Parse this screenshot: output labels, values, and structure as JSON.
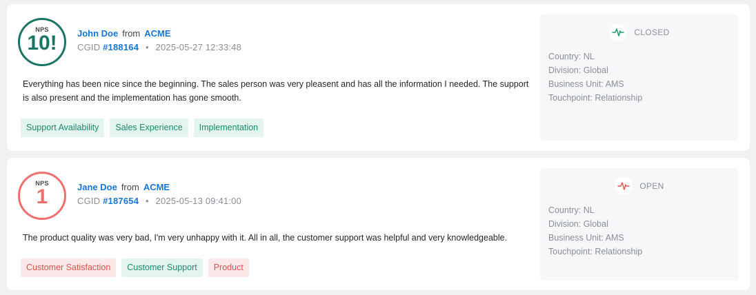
{
  "cards": [
    {
      "nps_label": "NPS",
      "score": "10!",
      "name": "John Doe",
      "from": "from",
      "org": "ACME",
      "cgid_label": "CGID",
      "cgid": "#188164",
      "dot": "•",
      "timestamp": "2025-05-27 12:33:48",
      "comment": "Everything has been nice since the beginning. The sales person was very pleasent and has all the information I needed. The support is also present and the implementation has gone smooth.",
      "tags": [
        "Support Availability",
        "Sales Experience",
        "Implementation"
      ],
      "tag_colors": [
        "green",
        "green",
        "green"
      ],
      "status": "CLOSED",
      "status_color": "#1a9a72",
      "status_icon": "pulse-icon",
      "country": "Country: NL",
      "division": "Division: Global",
      "business_unit": "Business Unit: AMS",
      "touchpoint": "Touchpoint: Relationship"
    },
    {
      "nps_label": "NPS",
      "score": "1",
      "name": "Jane Doe",
      "from": "from",
      "org": "ACME",
      "cgid_label": "CGID",
      "cgid": "#187654",
      "dot": "•",
      "timestamp": "2025-05-13 09:41:00",
      "comment": "The product quality was very bad, I'm very unhappy with it. All in all, the customer support was helpful and very knowledgeable.",
      "tags": [
        "Customer Satisfaction",
        "Customer Support",
        "Product"
      ],
      "tag_colors": [
        "red",
        "green",
        "red"
      ],
      "status": "OPEN",
      "status_color": "#e05a55",
      "status_icon": "pulse-icon",
      "country": "Country: NL",
      "division": "Division: Global",
      "business_unit": "Business Unit: AMS",
      "touchpoint": "Touchpoint: Relationship"
    }
  ]
}
